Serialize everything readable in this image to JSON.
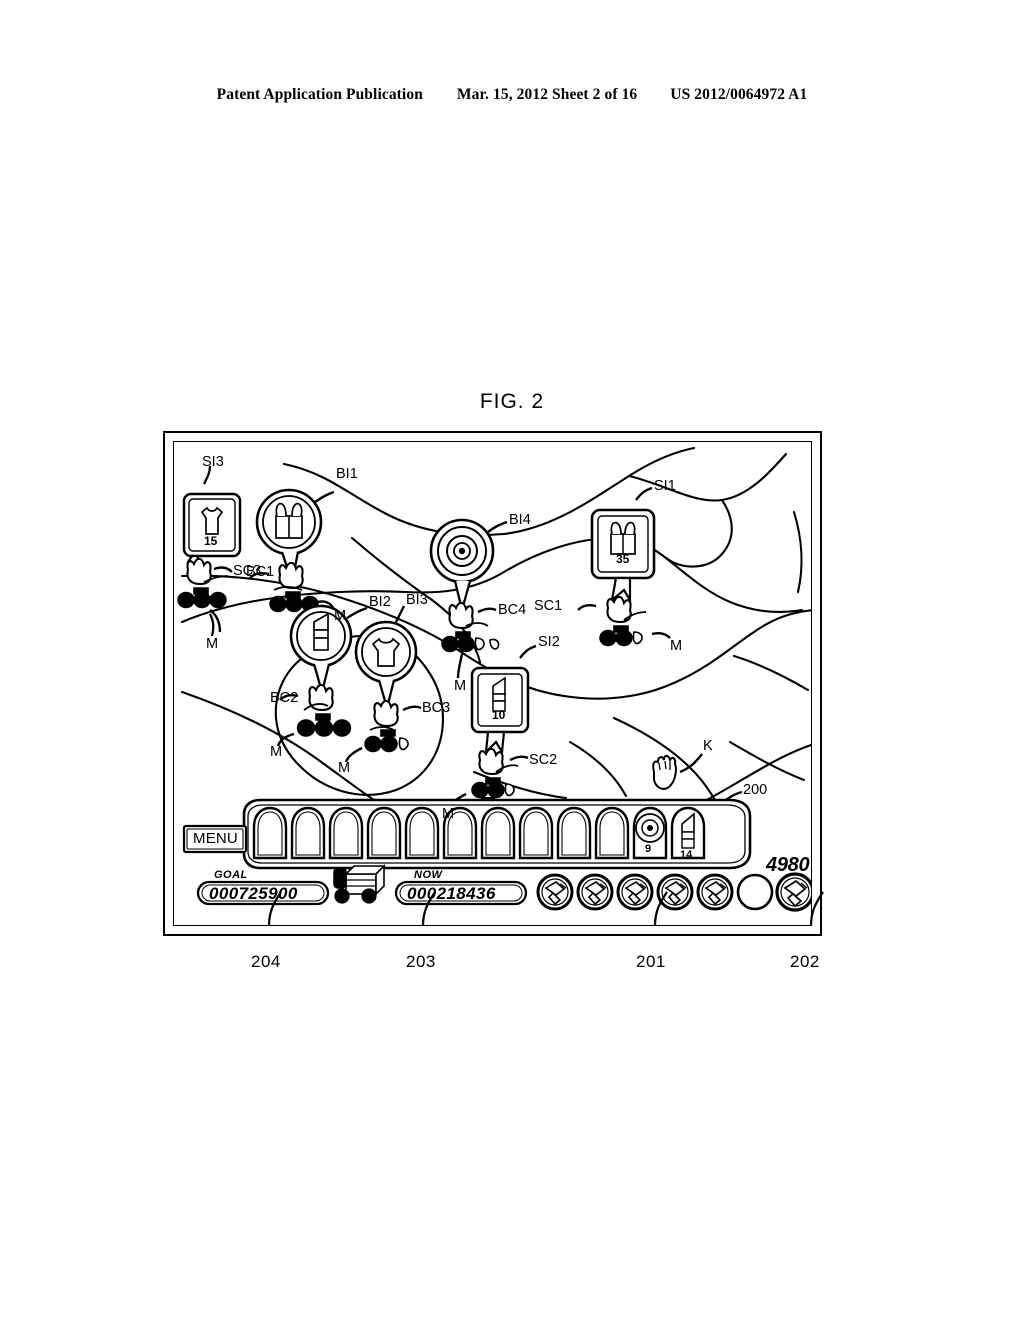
{
  "header": {
    "publication": "Patent Application Publication",
    "date_sheet": "Mar. 15, 2012  Sheet 2 of 16",
    "patent_number": "US 2012/0064972 A1"
  },
  "figure": {
    "title": "FIG. 2"
  },
  "map": {
    "balloon_items": [
      {
        "id": "BI1",
        "label": "BI1",
        "icon": "gift-box-icon",
        "shape": "circle"
      },
      {
        "id": "BI2",
        "label": "BI2",
        "icon": "lipstick-icon",
        "shape": "circle"
      },
      {
        "id": "BI3",
        "label": "BI3",
        "icon": "tshirt-icon",
        "shape": "circle"
      },
      {
        "id": "BI4",
        "label": "BI4",
        "icon": "target-icon",
        "shape": "circle"
      }
    ],
    "shop_items": [
      {
        "id": "SI1",
        "label": "SI1",
        "icon": "gift-box-icon",
        "value": "35",
        "shape": "rect"
      },
      {
        "id": "SI2",
        "label": "SI2",
        "icon": "lipstick-icon",
        "value": "10",
        "shape": "rect"
      },
      {
        "id": "SI3",
        "label": "SI3",
        "icon": "tshirt-icon",
        "value": "15",
        "shape": "rect"
      }
    ],
    "balloon_characters": [
      {
        "id": "BC1",
        "label": "BC1"
      },
      {
        "id": "BC2",
        "label": "BC2"
      },
      {
        "id": "BC3",
        "label": "BC3"
      },
      {
        "id": "BC4",
        "label": "BC4"
      }
    ],
    "shop_characters": [
      {
        "id": "SC1",
        "label": "SC1"
      },
      {
        "id": "SC2",
        "label": "SC2"
      },
      {
        "id": "SC3",
        "label": "SC3"
      }
    ],
    "merchandise_labels": [
      "M",
      "M",
      "M",
      "M",
      "M",
      "M"
    ],
    "cursor_label": "K"
  },
  "hud": {
    "menu_label": "MENU",
    "goal_label": "GOAL",
    "goal_value": "000725900",
    "now_label": "NOW",
    "now_value": "000218436",
    "truck_icon": "delivery-truck-icon",
    "score_value": "4980",
    "inventory_slots": [
      {
        "index": 1,
        "icon": "",
        "value": ""
      },
      {
        "index": 2,
        "icon": "",
        "value": ""
      },
      {
        "index": 3,
        "icon": "",
        "value": ""
      },
      {
        "index": 4,
        "icon": "",
        "value": ""
      },
      {
        "index": 5,
        "icon": "",
        "value": ""
      },
      {
        "index": 6,
        "icon": "",
        "value": ""
      },
      {
        "index": 7,
        "icon": "",
        "value": ""
      },
      {
        "index": 8,
        "icon": "",
        "value": ""
      },
      {
        "index": 9,
        "icon": "",
        "value": ""
      },
      {
        "index": 10,
        "icon": "",
        "value": ""
      },
      {
        "index": 11,
        "icon": "target-icon",
        "value": "9"
      },
      {
        "index": 12,
        "icon": "lipstick-icon",
        "value": "14"
      }
    ],
    "action_buttons": [
      {
        "index": 1,
        "icon": "hammer-icon",
        "filled": true
      },
      {
        "index": 2,
        "icon": "hammer-icon",
        "filled": true
      },
      {
        "index": 3,
        "icon": "hammer-icon",
        "filled": true
      },
      {
        "index": 4,
        "icon": "hammer-icon",
        "filled": true
      },
      {
        "index": 5,
        "icon": "hammer-icon",
        "filled": true
      },
      {
        "index": 6,
        "icon": "",
        "filled": false
      },
      {
        "index": 7,
        "icon": "hammer-icon",
        "filled": true
      }
    ]
  },
  "reference_numbers": [
    {
      "id": "200",
      "label": "200"
    },
    {
      "id": "201",
      "label": "201"
    },
    {
      "id": "202",
      "label": "202"
    },
    {
      "id": "203",
      "label": "203"
    },
    {
      "id": "204",
      "label": "204"
    }
  ]
}
